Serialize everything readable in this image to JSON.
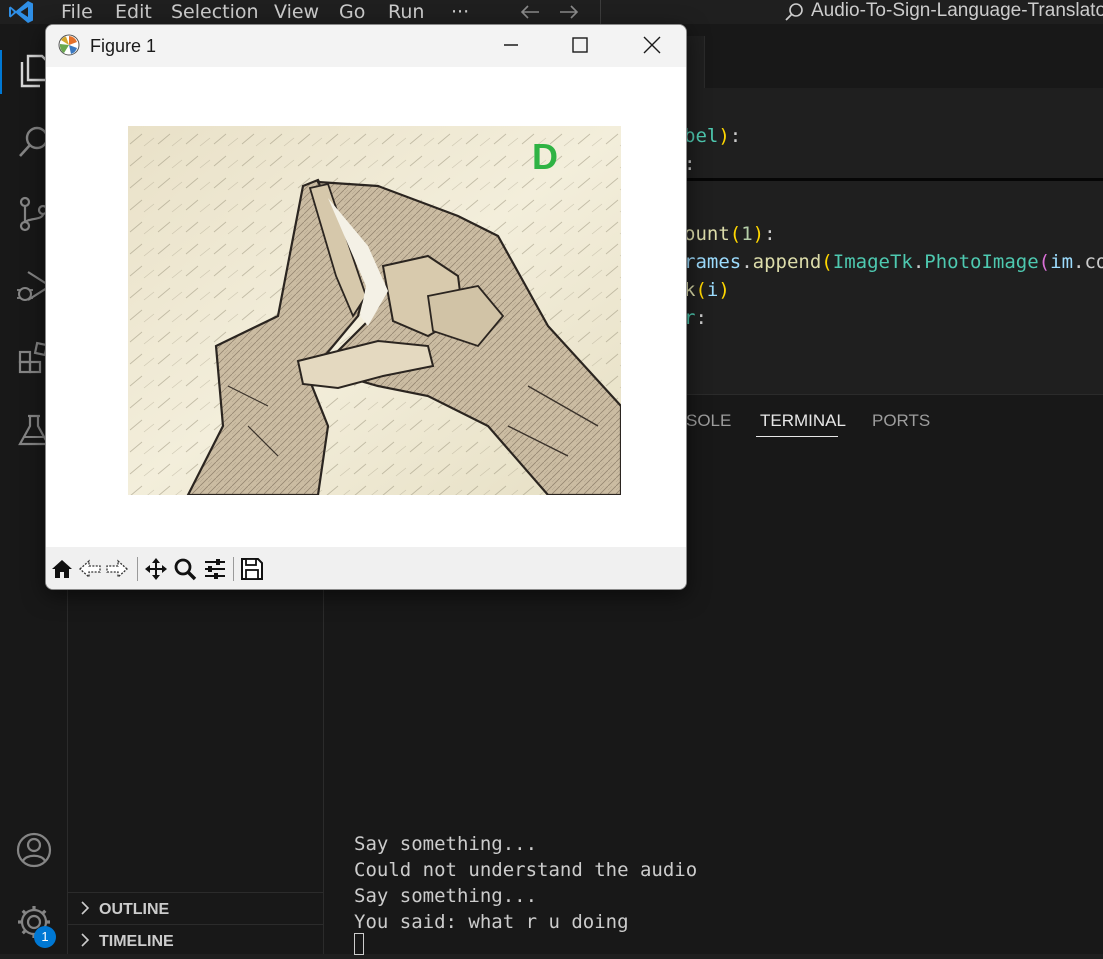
{
  "menubar": {
    "items": [
      "File",
      "Edit",
      "Selection",
      "View",
      "Go",
      "Run",
      "···"
    ],
    "nav_back_icon": "arrow-left-icon",
    "nav_forward_icon": "arrow-right-icon",
    "search_text": "Audio-To-Sign-Language-Translator-"
  },
  "activitybar": {
    "icons": [
      "explorer-icon",
      "search-icon",
      "source-control-icon",
      "run-debug-icon",
      "extensions-icon",
      "testing-icon",
      "accounts-icon",
      "manage-gear-icon"
    ],
    "manage_badge": "1"
  },
  "sidebar": {
    "sections": [
      "OUTLINE",
      "TIMELINE"
    ]
  },
  "editor": {
    "code_lines": [
      [
        {
          "t": "bel",
          "c": "#4ec9b0"
        },
        {
          "t": ")",
          "c": "#ffd700"
        },
        {
          "t": ":",
          "c": "#cccccc"
        }
      ],
      [
        {
          "t": ":",
          "c": "#cccccc"
        }
      ],
      [
        {
          "t": "ount",
          "c": "#dcdcaa"
        },
        {
          "t": "(",
          "c": "#ffd700"
        },
        {
          "t": "1",
          "c": "#b5cea8"
        },
        {
          "t": ")",
          "c": "#ffd700"
        },
        {
          "t": ":",
          "c": "#cccccc"
        }
      ],
      [
        {
          "t": "rames",
          "c": "#9cdcfe"
        },
        {
          "t": ".",
          "c": "#cccccc"
        },
        {
          "t": "append",
          "c": "#dcdcaa"
        },
        {
          "t": "(",
          "c": "#ffd700"
        },
        {
          "t": "ImageTk",
          "c": "#4ec9b0"
        },
        {
          "t": ".",
          "c": "#cccccc"
        },
        {
          "t": "PhotoImage",
          "c": "#4ec9b0"
        },
        {
          "t": "(",
          "c": "#da70d6"
        },
        {
          "t": "im",
          "c": "#9cdcfe"
        },
        {
          "t": ".co",
          "c": "#cccccc"
        }
      ],
      [
        {
          "t": "k",
          "c": "#dcdcaa"
        },
        {
          "t": "(",
          "c": "#ffd700"
        },
        {
          "t": "i",
          "c": "#9cdcfe"
        },
        {
          "t": ")",
          "c": "#ffd700"
        }
      ],
      [
        {
          "t": "r",
          "c": "#4ec9b0"
        },
        {
          "t": ":",
          "c": "#cccccc"
        }
      ]
    ]
  },
  "panel": {
    "tabs": [
      "SOLE",
      "TERMINAL",
      "PORTS"
    ],
    "active_tab": "TERMINAL",
    "terminal_lines": [
      "Say something...",
      "Could not understand the audio",
      "Say something...",
      "You said: what r u doing"
    ]
  },
  "figure": {
    "title": "Figure 1",
    "app_icon": "matplotlib-icon",
    "window_buttons": [
      "minimize-icon",
      "maximize-icon",
      "close-icon"
    ],
    "image_label": "D",
    "image_description_icon": "sign-language-hand-image",
    "label_color": "#2fb344",
    "toolbar": [
      "home-icon",
      "back-icon",
      "forward-icon",
      "pan-icon",
      "zoom-icon",
      "configure-subplots-icon",
      "save-icon"
    ]
  },
  "colors": {
    "accent": "#0078d4",
    "editor_bg": "#1f1f1f",
    "panel_bg": "#181818"
  }
}
